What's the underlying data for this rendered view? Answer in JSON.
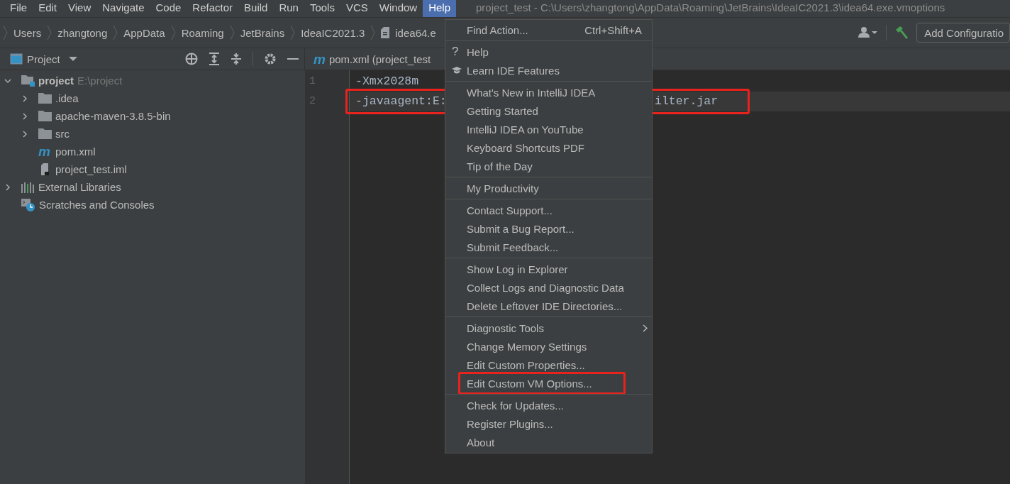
{
  "menubar": [
    {
      "label": "File",
      "selected": false
    },
    {
      "label": "Edit",
      "selected": false
    },
    {
      "label": "View",
      "selected": false
    },
    {
      "label": "Navigate",
      "selected": false
    },
    {
      "label": "Code",
      "selected": false
    },
    {
      "label": "Refactor",
      "selected": false
    },
    {
      "label": "Build",
      "selected": false
    },
    {
      "label": "Run",
      "selected": false
    },
    {
      "label": "Tools",
      "selected": false
    },
    {
      "label": "VCS",
      "selected": false
    },
    {
      "label": "Window",
      "selected": false
    },
    {
      "label": "Help",
      "selected": true
    }
  ],
  "window": {
    "title": "project_test - C:\\Users\\zhangtong\\AppData\\Roaming\\JetBrains\\IdeaIC2021.3\\idea64.exe.vmoptions"
  },
  "breadcrumbs": [
    {
      "label": "Users",
      "kind": "folder"
    },
    {
      "label": "zhangtong",
      "kind": "folder"
    },
    {
      "label": "AppData",
      "kind": "folder"
    },
    {
      "label": "Roaming",
      "kind": "folder"
    },
    {
      "label": "JetBrains",
      "kind": "folder"
    },
    {
      "label": "IdeaIC2021.3",
      "kind": "folder"
    },
    {
      "label": "idea64.e",
      "kind": "file"
    }
  ],
  "run_config": {
    "label": "Add Configuratio"
  },
  "project_panel": {
    "title": "Project"
  },
  "editor_tab": {
    "icon_glyph": "m",
    "label": "pom.xml (project_test"
  },
  "tree": [
    {
      "kind": "module",
      "label": "project",
      "path": "E:\\project",
      "expanded": true,
      "children": [
        {
          "kind": "folder",
          "label": ".idea",
          "expanded": false
        },
        {
          "kind": "folder",
          "label": "apache-maven-3.8.5-bin",
          "expanded": false
        },
        {
          "kind": "folder",
          "label": "src",
          "expanded": false
        },
        {
          "kind": "maven",
          "icon_glyph": "m",
          "label": "pom.xml"
        },
        {
          "kind": "file",
          "label": "project_test.iml"
        }
      ]
    },
    {
      "kind": "libraries",
      "label": "External Libraries",
      "expanded": false
    },
    {
      "kind": "scratches",
      "label": "Scratches and Consoles"
    }
  ],
  "editor": {
    "lines": [
      {
        "number": "1",
        "current": false,
        "annotated": false,
        "segments": [
          "-Xmx2028m"
        ]
      },
      {
        "number": "2",
        "current": true,
        "annotated": true,
        "segments": [
          "-javaagent:E:",
          "ilter.jar"
        ]
      }
    ]
  },
  "help_menu": {
    "groups": [
      [
        {
          "kind": "action",
          "label": "Find Action...",
          "shortcut": "Ctrl+Shift+A",
          "annotated": false
        }
      ],
      [
        {
          "kind": "help",
          "glyph": "?",
          "label": "Help",
          "annotated": false
        },
        {
          "kind": "learn",
          "label": "Learn IDE Features",
          "annotated": false
        }
      ],
      [
        {
          "kind": "action",
          "label": "What's New in IntelliJ IDEA",
          "annotated": false
        },
        {
          "kind": "action",
          "label": "Getting Started",
          "annotated": false
        },
        {
          "kind": "action",
          "label": "IntelliJ IDEA on YouTube",
          "annotated": false
        },
        {
          "kind": "action",
          "label": "Keyboard Shortcuts PDF",
          "annotated": false
        },
        {
          "kind": "action",
          "label": "Tip of the Day",
          "annotated": false
        }
      ],
      [
        {
          "kind": "action",
          "label": "My Productivity",
          "annotated": false
        }
      ],
      [
        {
          "kind": "action",
          "label": "Contact Support...",
          "annotated": false
        },
        {
          "kind": "action",
          "label": "Submit a Bug Report...",
          "annotated": false
        },
        {
          "kind": "action",
          "label": "Submit Feedback...",
          "annotated": false
        }
      ],
      [
        {
          "kind": "action",
          "label": "Show Log in Explorer",
          "annotated": false
        },
        {
          "kind": "action",
          "label": "Collect Logs and Diagnostic Data",
          "annotated": false
        },
        {
          "kind": "action",
          "label": "Delete Leftover IDE Directories...",
          "annotated": false
        }
      ],
      [
        {
          "kind": "submenu",
          "label": "Diagnostic Tools",
          "annotated": false
        },
        {
          "kind": "action",
          "label": "Change Memory Settings",
          "annotated": false
        },
        {
          "kind": "action",
          "label": "Edit Custom Properties...",
          "annotated": false
        },
        {
          "kind": "action",
          "label": "Edit Custom VM Options...",
          "annotated": true
        }
      ],
      [
        {
          "kind": "action",
          "label": "Check for Updates...",
          "annotated": false
        },
        {
          "kind": "action",
          "label": "Register Plugins...",
          "annotated": false
        },
        {
          "kind": "action",
          "label": "About",
          "annotated": false
        }
      ]
    ]
  }
}
